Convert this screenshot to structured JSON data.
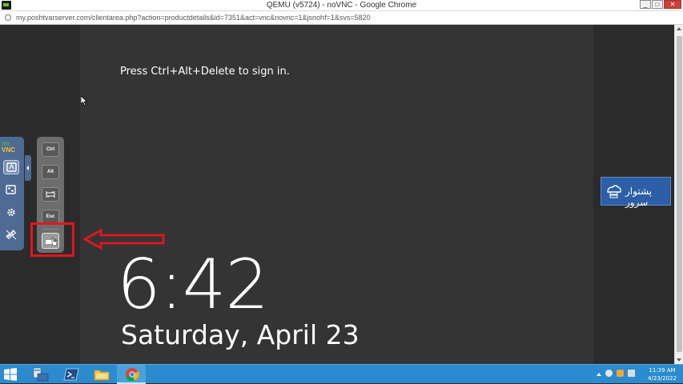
{
  "window": {
    "title": "QEMU (v5724) - noVNC - Google Chrome",
    "minimize_label": "_",
    "maximize_label": "□",
    "close_label": "✕"
  },
  "address_bar": {
    "url": "my.poshtvarserver.com/clientarea.php?action=productdetails&id=7351&act=vnc&novnc=1&jsnohf=1&svs=5820"
  },
  "remote_screen": {
    "prompt": "Press Ctrl+Alt+Delete to sign in.",
    "time": "6:42",
    "date": "Saturday, April 23"
  },
  "novnc_panel": {
    "logo_top": "no",
    "logo_bottom": "VNC",
    "buttons": [
      {
        "name": "view-only-button",
        "icon": "display-icon"
      },
      {
        "name": "clipboard-button",
        "icon": "clipboard-icon"
      },
      {
        "name": "settings-button",
        "icon": "gear-icon"
      },
      {
        "name": "disconnect-button",
        "icon": "disconnect-icon"
      }
    ]
  },
  "extra_keys": {
    "ctrl": "Ctrl",
    "alt": "Alt",
    "tab_icon": "tab-icon",
    "esc": "Esc",
    "ctrl_alt_del_icon": "keyboard-icon"
  },
  "annotation": {
    "highlight_color": "#e5151d"
  },
  "watermark": {
    "text": "پشتوار سرور"
  },
  "taskbar": {
    "apps": [
      {
        "name": "server-manager",
        "icon": "server-manager-icon"
      },
      {
        "name": "powershell",
        "icon": "powershell-icon"
      },
      {
        "name": "file-explorer",
        "icon": "folder-icon"
      },
      {
        "name": "chrome",
        "icon": "chrome-icon",
        "active": true
      }
    ],
    "time": "11:39 AM",
    "date": "4/23/2022"
  },
  "colors": {
    "taskbar": "#2c8bcf",
    "novnc_panel": "#4f6a93",
    "remote_bg": "#343434"
  }
}
